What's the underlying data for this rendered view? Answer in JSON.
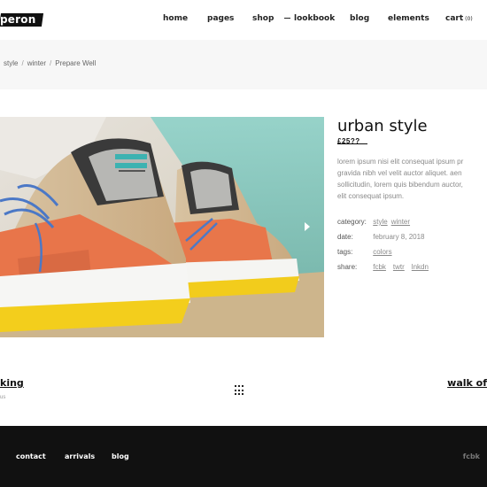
{
  "header": {
    "logo_text": "peron",
    "nav": {
      "home": "home",
      "pages": "pages",
      "shop": "shop",
      "lookbook": "lookbook",
      "blog": "blog",
      "elements": "elements",
      "cart": "cart",
      "cart_count": "(0)"
    }
  },
  "breadcrumb": {
    "items": [
      "style",
      "winter",
      "Prepare Well"
    ],
    "separator": "/"
  },
  "product": {
    "title": "urban style",
    "price_struck": "£25??",
    "description_lines": [
      "lorem ipsum nisi elit consequat ipsum pr",
      "gravida nibh vel velit auctor aliquet. aen",
      "sollicitudin, lorem quis bibendum auctor,",
      "elit consequat ipsum."
    ],
    "meta": {
      "category_label": "category:",
      "category_values": [
        "style",
        "winter"
      ],
      "date_label": "date:",
      "date_value": "february 8, 2018",
      "tags_label": "tags:",
      "tags_value": "colors",
      "share_label": "share:",
      "share_links": [
        "fcbk",
        "twtr",
        "lnkdn"
      ]
    }
  },
  "post_nav": {
    "prev_title": "king",
    "prev_sub": "us",
    "next_title": "walk of",
    "grid_icon": "grid-icon"
  },
  "footer": {
    "links": [
      "contact",
      "arrivals",
      "blog"
    ],
    "social": "fcbk"
  },
  "colors": {
    "accent_dark": "#111111",
    "muted_text": "#8a8a8a",
    "band_bg": "#f7f7f7"
  }
}
